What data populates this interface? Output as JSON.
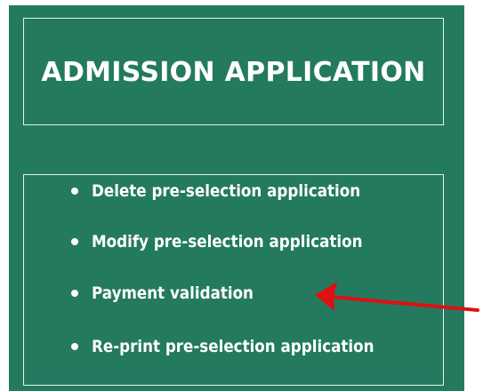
{
  "header": {
    "title": "ADMISSION APPLICATION"
  },
  "menu": {
    "items": [
      {
        "label": "Delete pre-selection application"
      },
      {
        "label": "Modify pre-selection application"
      },
      {
        "label": "Payment validation"
      },
      {
        "label": "Re-print pre-selection application"
      }
    ]
  },
  "annotation": {
    "type": "arrow",
    "color": "#e01010",
    "points_to": "Payment validation"
  },
  "colors": {
    "panel_background": "#237a5f",
    "border": "#e6f2ec",
    "text": "#ffffff"
  }
}
